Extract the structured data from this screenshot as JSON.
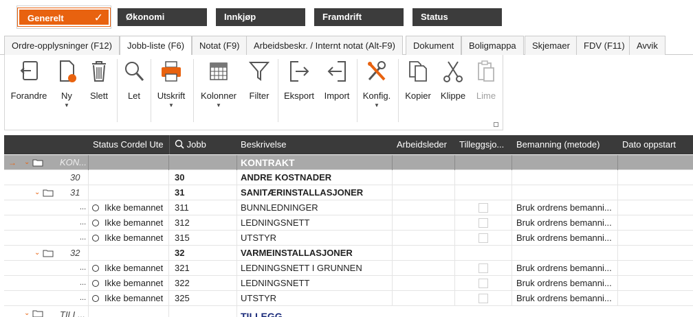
{
  "top_tabs": [
    {
      "label": "Generelt"
    },
    {
      "label": "Økonomi"
    },
    {
      "label": "Innkjøp"
    },
    {
      "label": "Framdrift"
    },
    {
      "label": "Status"
    }
  ],
  "tabs": [
    {
      "label": "Ordre-opplysninger (F12)"
    },
    {
      "label": "Jobb-liste (F6)"
    },
    {
      "label": "Notat (F9)"
    },
    {
      "label": "Arbeidsbeskr. / Internt notat (Alt-F9)"
    },
    {
      "label": "Dokument"
    },
    {
      "label": "Boligmappa"
    },
    {
      "label": "Skjemaer"
    },
    {
      "label": "FDV (F11)"
    },
    {
      "label": "Avvik"
    }
  ],
  "ribbon": {
    "forandre": "Forandre",
    "ny": "Ny",
    "slett": "Slett",
    "let": "Let",
    "utskrift": "Utskrift",
    "kolonner": "Kolonner",
    "filter": "Filter",
    "eksport": "Eksport",
    "import": "Import",
    "konfig": "Konfig.",
    "kopier": "Kopier",
    "klippe": "Klippe",
    "lime": "Lime"
  },
  "grid": {
    "headers": {
      "status": "Status Cordel Ute",
      "jobb": "Jobb",
      "beskrivelse": "Beskrivelse",
      "arbeidsleder": "Arbeidsleder",
      "tillegg": "Tilleggsjo...",
      "bemanning": "Bemanning (metode)",
      "dato": "Dato oppstart"
    },
    "rows": [
      {
        "tree": "KON...",
        "status": "",
        "jobb": "",
        "beskrivelse": "KONTRAKT",
        "bemanning": ""
      },
      {
        "tree": "30",
        "status": "",
        "jobb": "30",
        "beskrivelse": "ANDRE KOSTNADER",
        "bemanning": ""
      },
      {
        "tree": "31",
        "status": "",
        "jobb": "31",
        "beskrivelse": "SANITÆRINSTALLASJONER",
        "bemanning": ""
      },
      {
        "tree": "...",
        "status": "Ikke bemannet",
        "jobb": "311",
        "beskrivelse": "BUNNLEDNINGER",
        "bemanning": "Bruk ordrens bemanni..."
      },
      {
        "tree": "...",
        "status": "Ikke bemannet",
        "jobb": "312",
        "beskrivelse": "LEDNINGSNETT",
        "bemanning": "Bruk ordrens bemanni..."
      },
      {
        "tree": "...",
        "status": "Ikke bemannet",
        "jobb": "315",
        "beskrivelse": "UTSTYR",
        "bemanning": "Bruk ordrens bemanni..."
      },
      {
        "tree": "32",
        "status": "",
        "jobb": "32",
        "beskrivelse": "VARMEINSTALLASJONER",
        "bemanning": ""
      },
      {
        "tree": "...",
        "status": "Ikke bemannet",
        "jobb": "321",
        "beskrivelse": "LEDNINGSNETT I GRUNNEN",
        "bemanning": "Bruk ordrens bemanni..."
      },
      {
        "tree": "...",
        "status": "Ikke bemannet",
        "jobb": "322",
        "beskrivelse": "LEDNINGSNETT",
        "bemanning": "Bruk ordrens bemanni..."
      },
      {
        "tree": "...",
        "status": "Ikke bemannet",
        "jobb": "325",
        "beskrivelse": "UTSTYR",
        "bemanning": "Bruk ordrens bemanni..."
      },
      {
        "tree": "TILL...",
        "status": "",
        "jobb": "",
        "beskrivelse": "TILLEGG",
        "bemanning": ""
      }
    ]
  },
  "colors": {
    "accent": "#e8620f",
    "header_bg": "#3a3a3a",
    "group_row": "#a9a9a9"
  }
}
